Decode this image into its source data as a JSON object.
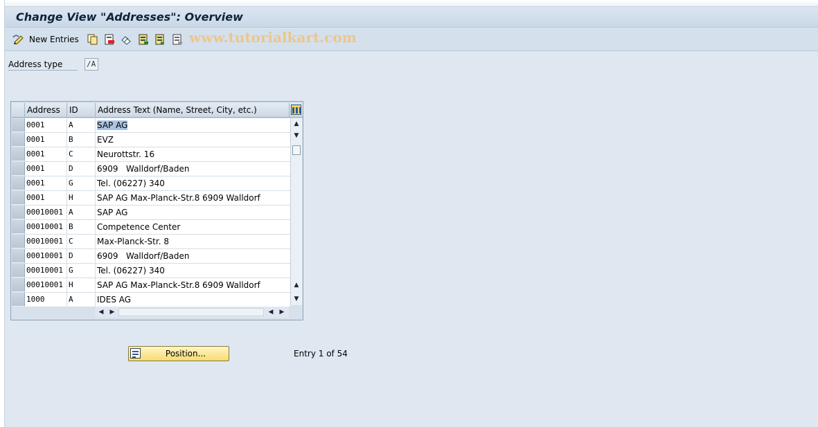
{
  "window": {
    "title": "Change View \"Addresses\": Overview"
  },
  "toolbar": {
    "new_entries_label": "New Entries",
    "icons": [
      "edit-pencil-icon",
      "copy-icon",
      "delete-icon",
      "undo-change-icon",
      "select-all-icon",
      "select-block-icon",
      "deselect-all-icon"
    ],
    "watermark": "www.tutorialkart.com"
  },
  "filter": {
    "label": "Address type",
    "value": "/A"
  },
  "table": {
    "columns": [
      "Address",
      "ID",
      "Address Text (Name, Street, City, etc.)"
    ],
    "rows": [
      {
        "address": "0001",
        "id": "A",
        "text": "SAP AG"
      },
      {
        "address": "0001",
        "id": "B",
        "text": "EVZ"
      },
      {
        "address": "0001",
        "id": "C",
        "text": "Neurottstr. 16"
      },
      {
        "address": "0001",
        "id": "D",
        "text": "6909   Walldorf/Baden"
      },
      {
        "address": "0001",
        "id": "G",
        "text": "Tel. (06227) 340"
      },
      {
        "address": "0001",
        "id": "H",
        "text": "SAP AG Max-Planck-Str.8 6909 Walldorf"
      },
      {
        "address": "00010001",
        "id": "A",
        "text": "SAP AG"
      },
      {
        "address": "00010001",
        "id": "B",
        "text": "Competence Center"
      },
      {
        "address": "00010001",
        "id": "C",
        "text": "Max-Planck-Str. 8"
      },
      {
        "address": "00010001",
        "id": "D",
        "text": "6909   Walldorf/Baden"
      },
      {
        "address": "00010001",
        "id": "G",
        "text": "Tel. (06227) 340"
      },
      {
        "address": "00010001",
        "id": "H",
        "text": "SAP AG Max-Planck-Str.8 6909 Walldorf"
      },
      {
        "address": "1000",
        "id": "A",
        "text": "IDES AG"
      }
    ],
    "highlighted_row": 0
  },
  "footer": {
    "position_button_label": "Position...",
    "entry_info": "Entry 1 of 54"
  },
  "colors": {
    "background": "#dfe8f1",
    "title_text": "#10223a",
    "selection_highlight": "#aac4e3",
    "position_button": "#f6dc74",
    "watermark": "#efc586"
  }
}
